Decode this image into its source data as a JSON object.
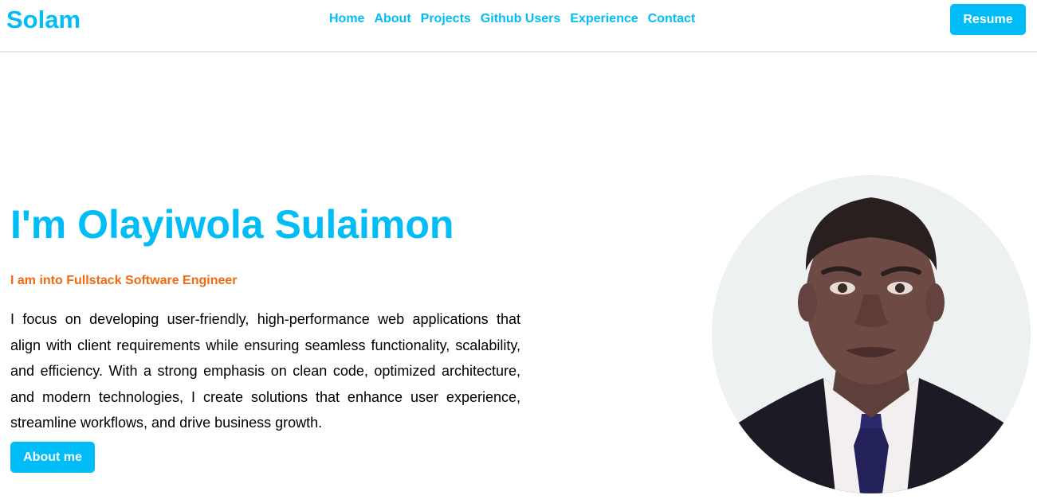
{
  "header": {
    "logo": "Solam",
    "nav": [
      "Home",
      "About",
      "Projects",
      "Github Users",
      "Experience",
      "Contact"
    ],
    "resume_label": "Resume"
  },
  "hero": {
    "title": "I'm Olayiwola Sulaimon",
    "subtitle": "I am into Fullstack Software Engineer",
    "description": "I focus on developing user-friendly, high-performance web applications that align with client requirements while ensuring seamless functionality, scalability, and efficiency. With a strong emphasis on clean code, optimized architecture, and modern technologies, I create solutions that enhance user experience, streamline workflows, and drive business growth.",
    "about_label": "About me"
  },
  "colors": {
    "accent": "#00bdf7",
    "subtitle": "#f26a0f",
    "text": "#000000"
  }
}
